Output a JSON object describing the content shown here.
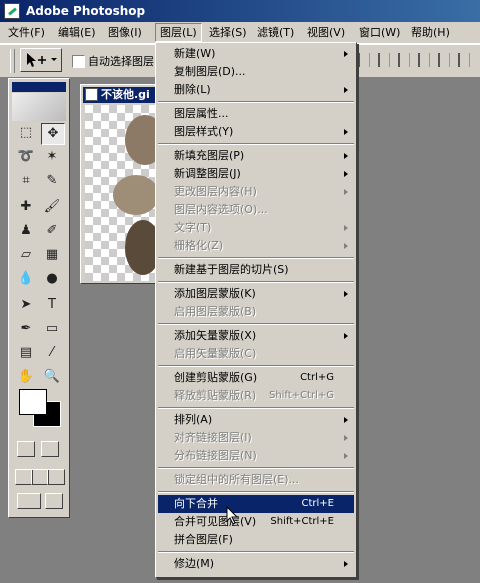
{
  "window": {
    "title": "Adobe Photoshop"
  },
  "menubar": [
    {
      "label": "文件(F)"
    },
    {
      "label": "编辑(E)"
    },
    {
      "label": "图像(I)"
    },
    {
      "label": "图层(L)"
    },
    {
      "label": "选择(S)"
    },
    {
      "label": "滤镜(T)"
    },
    {
      "label": "视图(V)"
    },
    {
      "label": "窗口(W)"
    },
    {
      "label": "帮助(H)"
    }
  ],
  "options": {
    "auto_select_label": "自动选择图层"
  },
  "document": {
    "title": "不该他.gi"
  },
  "menu": {
    "items": [
      {
        "label": "新建(W)",
        "submenu": true
      },
      {
        "label": "复制图层(D)..."
      },
      {
        "label": "删除(L)",
        "submenu": true
      },
      {
        "label": "图层属性..."
      },
      {
        "label": "图层样式(Y)",
        "submenu": true
      },
      {
        "label": "新填充图层(P)",
        "submenu": true
      },
      {
        "label": "新调整图层(J)",
        "submenu": true
      },
      {
        "label": "更改图层内容(H)",
        "submenu": true,
        "disabled": true
      },
      {
        "label": "图层内容选项(O)...",
        "disabled": true
      },
      {
        "label": "文字(T)",
        "submenu": true,
        "disabled": true
      },
      {
        "label": "栅格化(Z)",
        "submenu": true,
        "disabled": true
      },
      {
        "label": "新建基于图层的切片(S)"
      },
      {
        "label": "添加图层蒙版(K)",
        "submenu": true
      },
      {
        "label": "启用图层蒙版(B)",
        "disabled": true
      },
      {
        "label": "添加矢量蒙版(X)",
        "submenu": true
      },
      {
        "label": "启用矢量蒙版(C)",
        "disabled": true
      },
      {
        "label": "创建剪贴蒙版(G)",
        "shortcut": "Ctrl+G"
      },
      {
        "label": "释放剪贴蒙版(R)",
        "shortcut": "Shift+Ctrl+G",
        "disabled": true
      },
      {
        "label": "排列(A)",
        "submenu": true
      },
      {
        "label": "对齐链接图层(I)",
        "submenu": true,
        "disabled": true
      },
      {
        "label": "分布链接图层(N)",
        "submenu": true,
        "disabled": true
      },
      {
        "label": "锁定组中的所有图层(E)...",
        "disabled": true
      },
      {
        "label": "向下合并",
        "shortcut": "Ctrl+E",
        "highlighted": true
      },
      {
        "label": "合并可见图层(V)",
        "shortcut": "Shift+Ctrl+E"
      },
      {
        "label": "拼合图层(F)"
      },
      {
        "label": "修边(M)",
        "submenu": true
      }
    ]
  },
  "colors": {
    "title_bar": "#0a246a",
    "menu_bg": "#d4d0c8",
    "highlight": "#0a246a"
  }
}
